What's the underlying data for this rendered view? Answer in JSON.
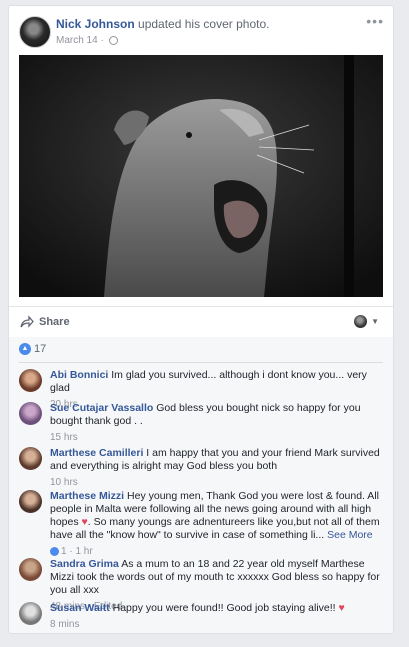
{
  "post": {
    "author": "Nick Johnson",
    "action": "updated his cover photo.",
    "date": "March 14",
    "dot": "·",
    "more": "•••"
  },
  "share": {
    "label": "Share"
  },
  "likes": {
    "count": "17"
  },
  "comments": [
    {
      "name": "Abi Bonnici",
      "text": "Im glad you survived... although i dont know you... very glad",
      "time": "20 hrs"
    },
    {
      "name": "Sue Cutajar Vassallo",
      "text": "God bless you bought nick so happy for you bought thank god . .",
      "time": "15 hrs"
    },
    {
      "name": "Marthese Camilleri",
      "text": "I am happy that you and your friend Mark survived and everything is alright may God bless you both",
      "time": "10 hrs"
    },
    {
      "name": "Marthese Mizzi",
      "text": "Hey young men, Thank God you were lost & found. All people in Malta were following all the news going around with all high hopes",
      "text2": ". So many youngs are adnentureers like you,but not all of them have all the \"know how\" to survive in case of something li...",
      "see_more": "See More",
      "reactions": "1",
      "time": "1 hr"
    },
    {
      "name": "Sandra Grima",
      "text": "As a mum to an 18 and 22 year old myself Marthese Mizzi took the words out of my mouth tc xxxxxx God bless so happy for you all xxx",
      "time": "48 mins · Edited"
    },
    {
      "name": "Susan Waitt",
      "text": "Happy you were found!! Good job staying alive!!",
      "time": "8 mins"
    }
  ],
  "icons": {
    "heart": "♥",
    "like": "👍",
    "caret": "▼"
  },
  "colors": {
    "link": "#365899",
    "muted": "#90949c",
    "like_blue": "#4b8bec",
    "heart": "#e0465e"
  }
}
